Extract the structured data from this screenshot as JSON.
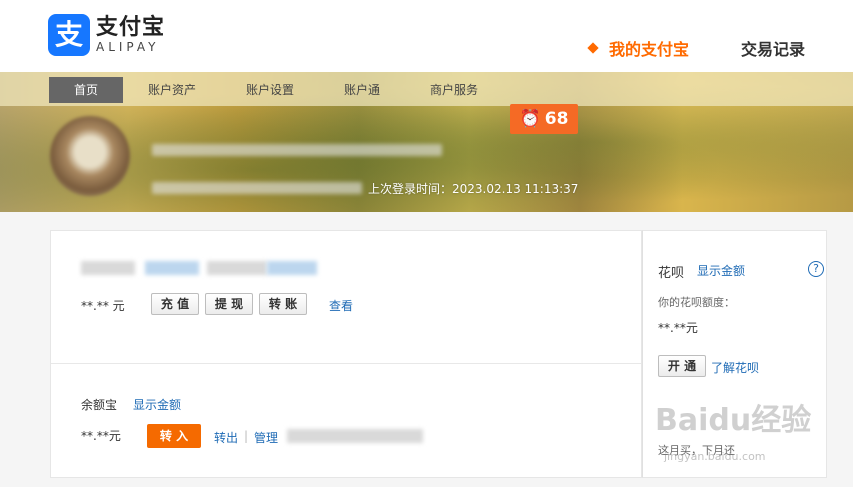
{
  "header": {
    "logo_mark": "支",
    "logo_cn": "支付宝",
    "logo_en": "ALIPAY",
    "nav_active": "我的支付宝",
    "nav_other": "交易记录"
  },
  "subnav": {
    "items": [
      "首页",
      "账户资产",
      "账户设置",
      "账户通",
      "商户服务"
    ]
  },
  "banner": {
    "alarm_count": "68",
    "last_login": "上次登录时间：2023.02.13 11:13:37"
  },
  "account": {
    "amount": "**.** 元",
    "recharge": "充 值",
    "withdraw": "提 现",
    "transfer": "转 账",
    "view": "查看"
  },
  "yuebao": {
    "title": "余额宝",
    "show_amount": "显示金额",
    "amount": "**.**元",
    "transfer_in": "转 入",
    "transfer_out": "转出",
    "separator": "|",
    "manage": "管理"
  },
  "huabei": {
    "title": "花呗",
    "show_amount": "显示金额",
    "help": "?",
    "credit_label": "你的花呗额度：",
    "credit_amount": "**.**元",
    "activate": "开 通",
    "learn": "了解花呗",
    "tagline": "这月买，下月还"
  },
  "watermark": {
    "text": "Baidu经验",
    "sub": "jingyan.baidu.com"
  },
  "colors": {
    "accent": "#ff6a00",
    "link": "#1f6bb5",
    "brand": "#1677ff"
  }
}
